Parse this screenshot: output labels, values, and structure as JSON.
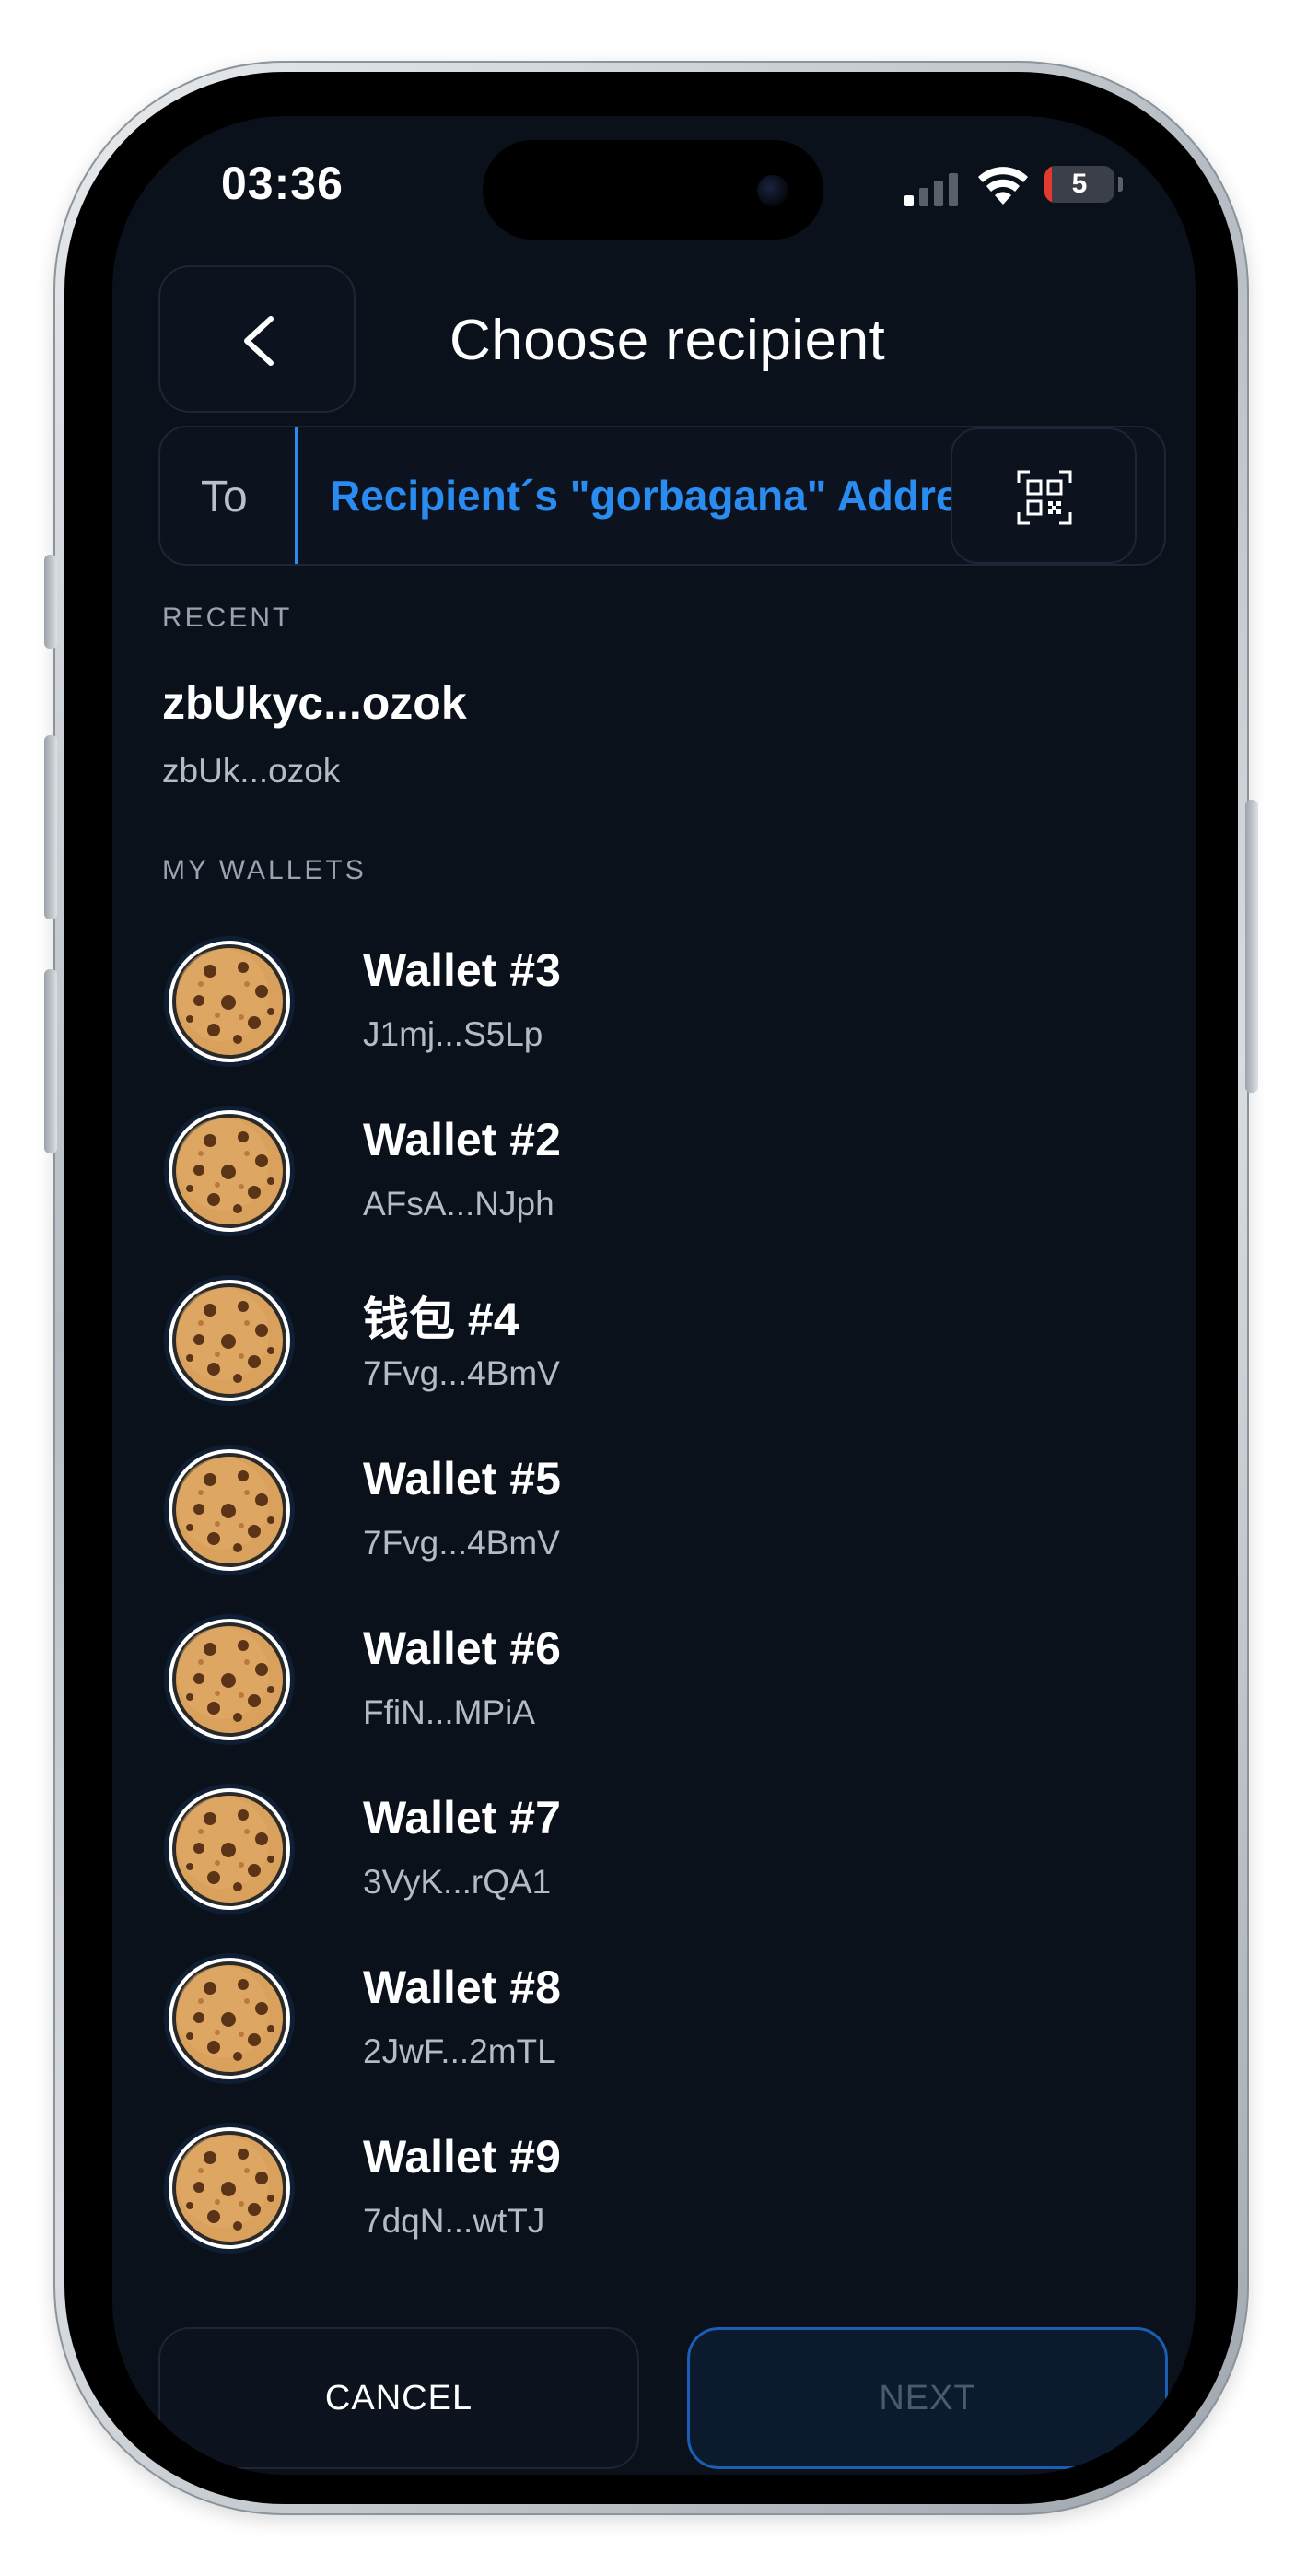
{
  "status_bar": {
    "time": "03:36",
    "battery_level": "5",
    "battery_fraction": 0.05,
    "icons": [
      "cellular-signal-icon",
      "wifi-icon",
      "battery-icon"
    ]
  },
  "header": {
    "title": "Choose recipient",
    "back_icon": "chevron-left-icon"
  },
  "recipient_field": {
    "label": "To",
    "placeholder": "Recipient´s \"gorbagana\" Address",
    "value": "",
    "scan_icon": "qr-scan-icon"
  },
  "recent": {
    "section_title": "RECENT",
    "items": [
      {
        "name": "zbUkyc...ozok",
        "address": "zbUk...ozok"
      }
    ]
  },
  "my_wallets": {
    "section_title": "MY WALLETS",
    "avatar_icon": "cookie-icon",
    "items": [
      {
        "name": "Wallet #3",
        "address": "J1mj...S5Lp"
      },
      {
        "name": "Wallet #2",
        "address": "AFsA...NJph"
      },
      {
        "name": "钱包 #4",
        "address": "7Fvg...4BmV"
      },
      {
        "name": "Wallet #5",
        "address": "7Fvg...4BmV"
      },
      {
        "name": "Wallet #6",
        "address": "FfiN...MPiA"
      },
      {
        "name": "Wallet #7",
        "address": "3VyK...rQA1"
      },
      {
        "name": "Wallet #8",
        "address": "2JwF...2mTL"
      },
      {
        "name": "Wallet #9",
        "address": "7dqN...wtTJ"
      }
    ]
  },
  "footer": {
    "cancel_label": "CANCEL",
    "next_label": "NEXT",
    "next_enabled": false
  },
  "colors": {
    "background": "#0a111b",
    "accent": "#2a8cf0",
    "next_border": "#1a5fb4",
    "muted_text": "#b4bbc5",
    "cookie": "#d9a15b"
  }
}
